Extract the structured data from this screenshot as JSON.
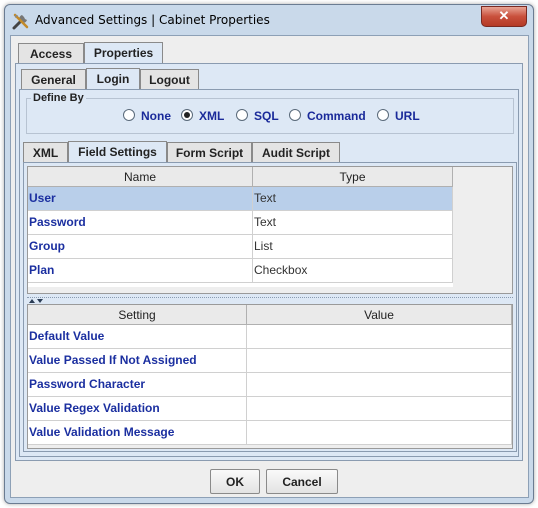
{
  "window": {
    "title": "Advanced Settings | Cabinet Properties",
    "close_glyph": "✕"
  },
  "tabs_top": [
    {
      "label": "Access"
    },
    {
      "label": "Properties"
    }
  ],
  "tabs_sub": [
    {
      "label": "General"
    },
    {
      "label": "Login"
    },
    {
      "label": "Logout"
    }
  ],
  "define_by": {
    "legend": "Define By",
    "options": [
      {
        "label": "None",
        "selected": false
      },
      {
        "label": "XML",
        "selected": true
      },
      {
        "label": "SQL",
        "selected": false
      },
      {
        "label": "Command",
        "selected": false
      },
      {
        "label": "URL",
        "selected": false
      }
    ]
  },
  "tabs_inner": [
    {
      "label": "XML"
    },
    {
      "label": "Field Settings"
    },
    {
      "label": "Form Script"
    },
    {
      "label": "Audit Script"
    }
  ],
  "fields_table": {
    "headers": [
      "Name",
      "Type"
    ],
    "rows": [
      {
        "name": "User",
        "type": "Text",
        "selected": true
      },
      {
        "name": "Password",
        "type": "Text",
        "selected": false
      },
      {
        "name": "Group",
        "type": "List",
        "selected": false
      },
      {
        "name": "Plan",
        "type": "Checkbox",
        "selected": false
      }
    ]
  },
  "settings_table": {
    "headers": [
      "Setting",
      "Value"
    ],
    "rows": [
      {
        "setting": "Default Value",
        "value": ""
      },
      {
        "setting": "Value Passed If Not Assigned",
        "value": ""
      },
      {
        "setting": "Password Character",
        "value": ""
      },
      {
        "setting": "Value Regex Validation",
        "value": ""
      },
      {
        "setting": "Value Validation Message",
        "value": ""
      }
    ]
  },
  "buttons": {
    "ok": "OK",
    "cancel": "Cancel"
  }
}
